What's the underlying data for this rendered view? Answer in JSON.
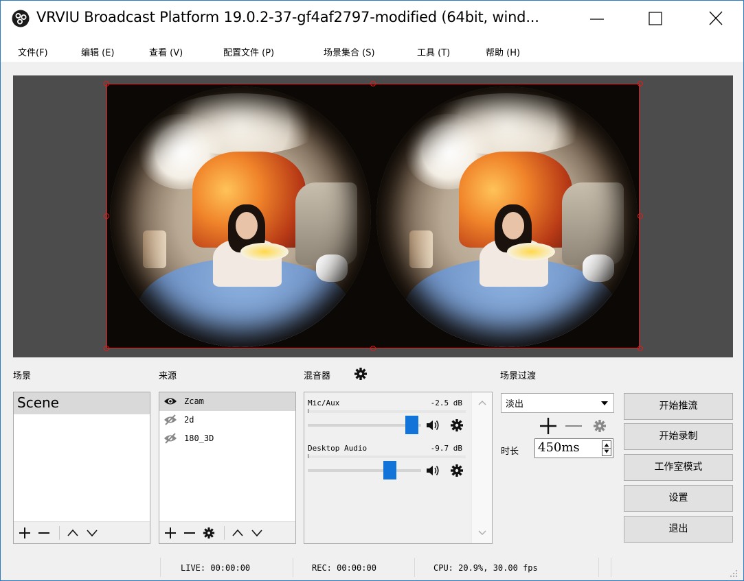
{
  "window": {
    "title": "VRVIU Broadcast Platform 19.0.2-37-gf4af2797-modified (64bit, wind..."
  },
  "menu": {
    "items": [
      {
        "label": "文件(F)"
      },
      {
        "label": "编辑 (E)"
      },
      {
        "label": "查看 (V)"
      },
      {
        "label": "配置文件 (P)"
      },
      {
        "label": "场景集合 (S)"
      },
      {
        "label": "工具 (T)"
      },
      {
        "label": "帮助 (H)"
      }
    ]
  },
  "docks": {
    "scenes_label": "场景",
    "sources_label": "来源",
    "mixer_label": "混音器",
    "transitions_label": "场景过渡"
  },
  "scenes": {
    "items": [
      {
        "label": "Scene"
      }
    ]
  },
  "sources": {
    "items": [
      {
        "label": "Zcam",
        "visible": true
      },
      {
        "label": "2d",
        "visible": false
      },
      {
        "label": "180_3D",
        "visible": false
      }
    ]
  },
  "mixer": {
    "channels": [
      {
        "name": "Mic/Aux",
        "db": "-2.5 dB",
        "volume_fraction": 0.92
      },
      {
        "name": "Desktop Audio",
        "db": "-9.7 dB",
        "volume_fraction": 0.72
      }
    ]
  },
  "transitions": {
    "selected": "淡出",
    "duration_label": "时长",
    "duration_value": "450ms"
  },
  "controls": {
    "start_streaming": "开始推流",
    "start_recording": "开始录制",
    "studio_mode": "工作室模式",
    "settings": "设置",
    "exit": "退出"
  },
  "status": {
    "live": "LIVE: 00:00:00",
    "rec": "REC: 00:00:00",
    "cpu": "CPU: 20.9%, 30.00 fps"
  },
  "colors": {
    "accent": "#1273d8",
    "selection_border": "#e01b1b"
  }
}
